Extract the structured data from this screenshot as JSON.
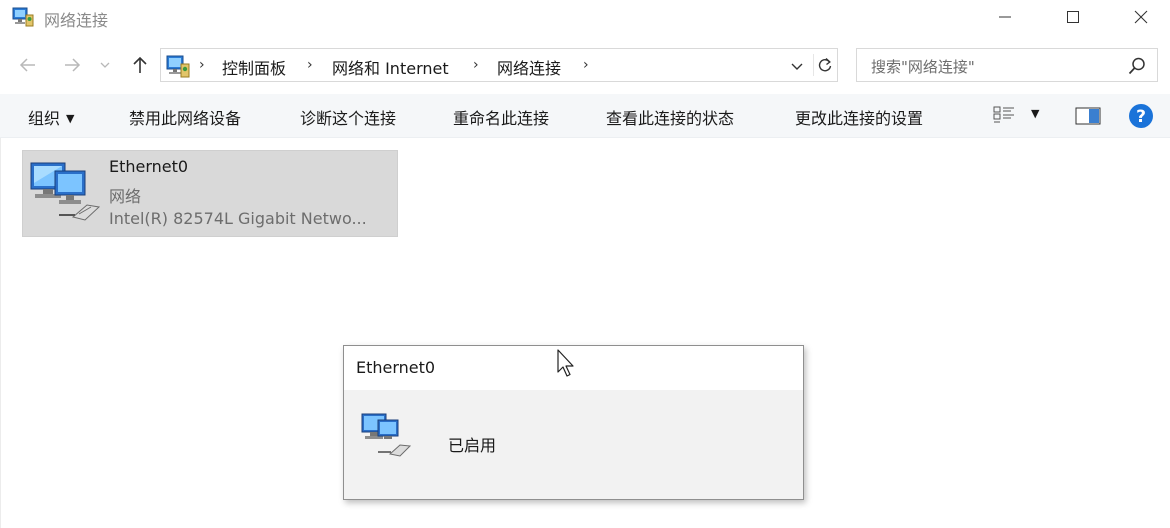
{
  "window": {
    "title": "网络连接",
    "icon": "network-connections-icon",
    "controls": [
      "minimize-icon",
      "maximize-icon",
      "close-icon"
    ]
  },
  "address_bar": {
    "breadcrumbs": [
      "控制面板",
      "网络和 Internet",
      "网络连接"
    ],
    "separator": "›"
  },
  "search": {
    "placeholder": "搜索\"网络连接\""
  },
  "command_bar": {
    "organize": "组织",
    "caret": "▼",
    "commands": [
      "禁用此网络设备",
      "诊断这个连接",
      "重命名此连接",
      "查看此连接的状态",
      "更改此连接的设置"
    ]
  },
  "connection": {
    "name": "Ethernet0",
    "type": "网络",
    "adapter": "Intel(R) 82574L Gigabit Netwo..."
  },
  "popup": {
    "title": "Ethernet0",
    "status": "已启用"
  },
  "colors": {
    "command_bar_bg": "#f5f7f9",
    "selected_item_bg": "#d9d9d9",
    "popup_bg": "#f2f2f2",
    "help_blue": "#1a73d9",
    "muted_text": "#6d6d6d"
  }
}
